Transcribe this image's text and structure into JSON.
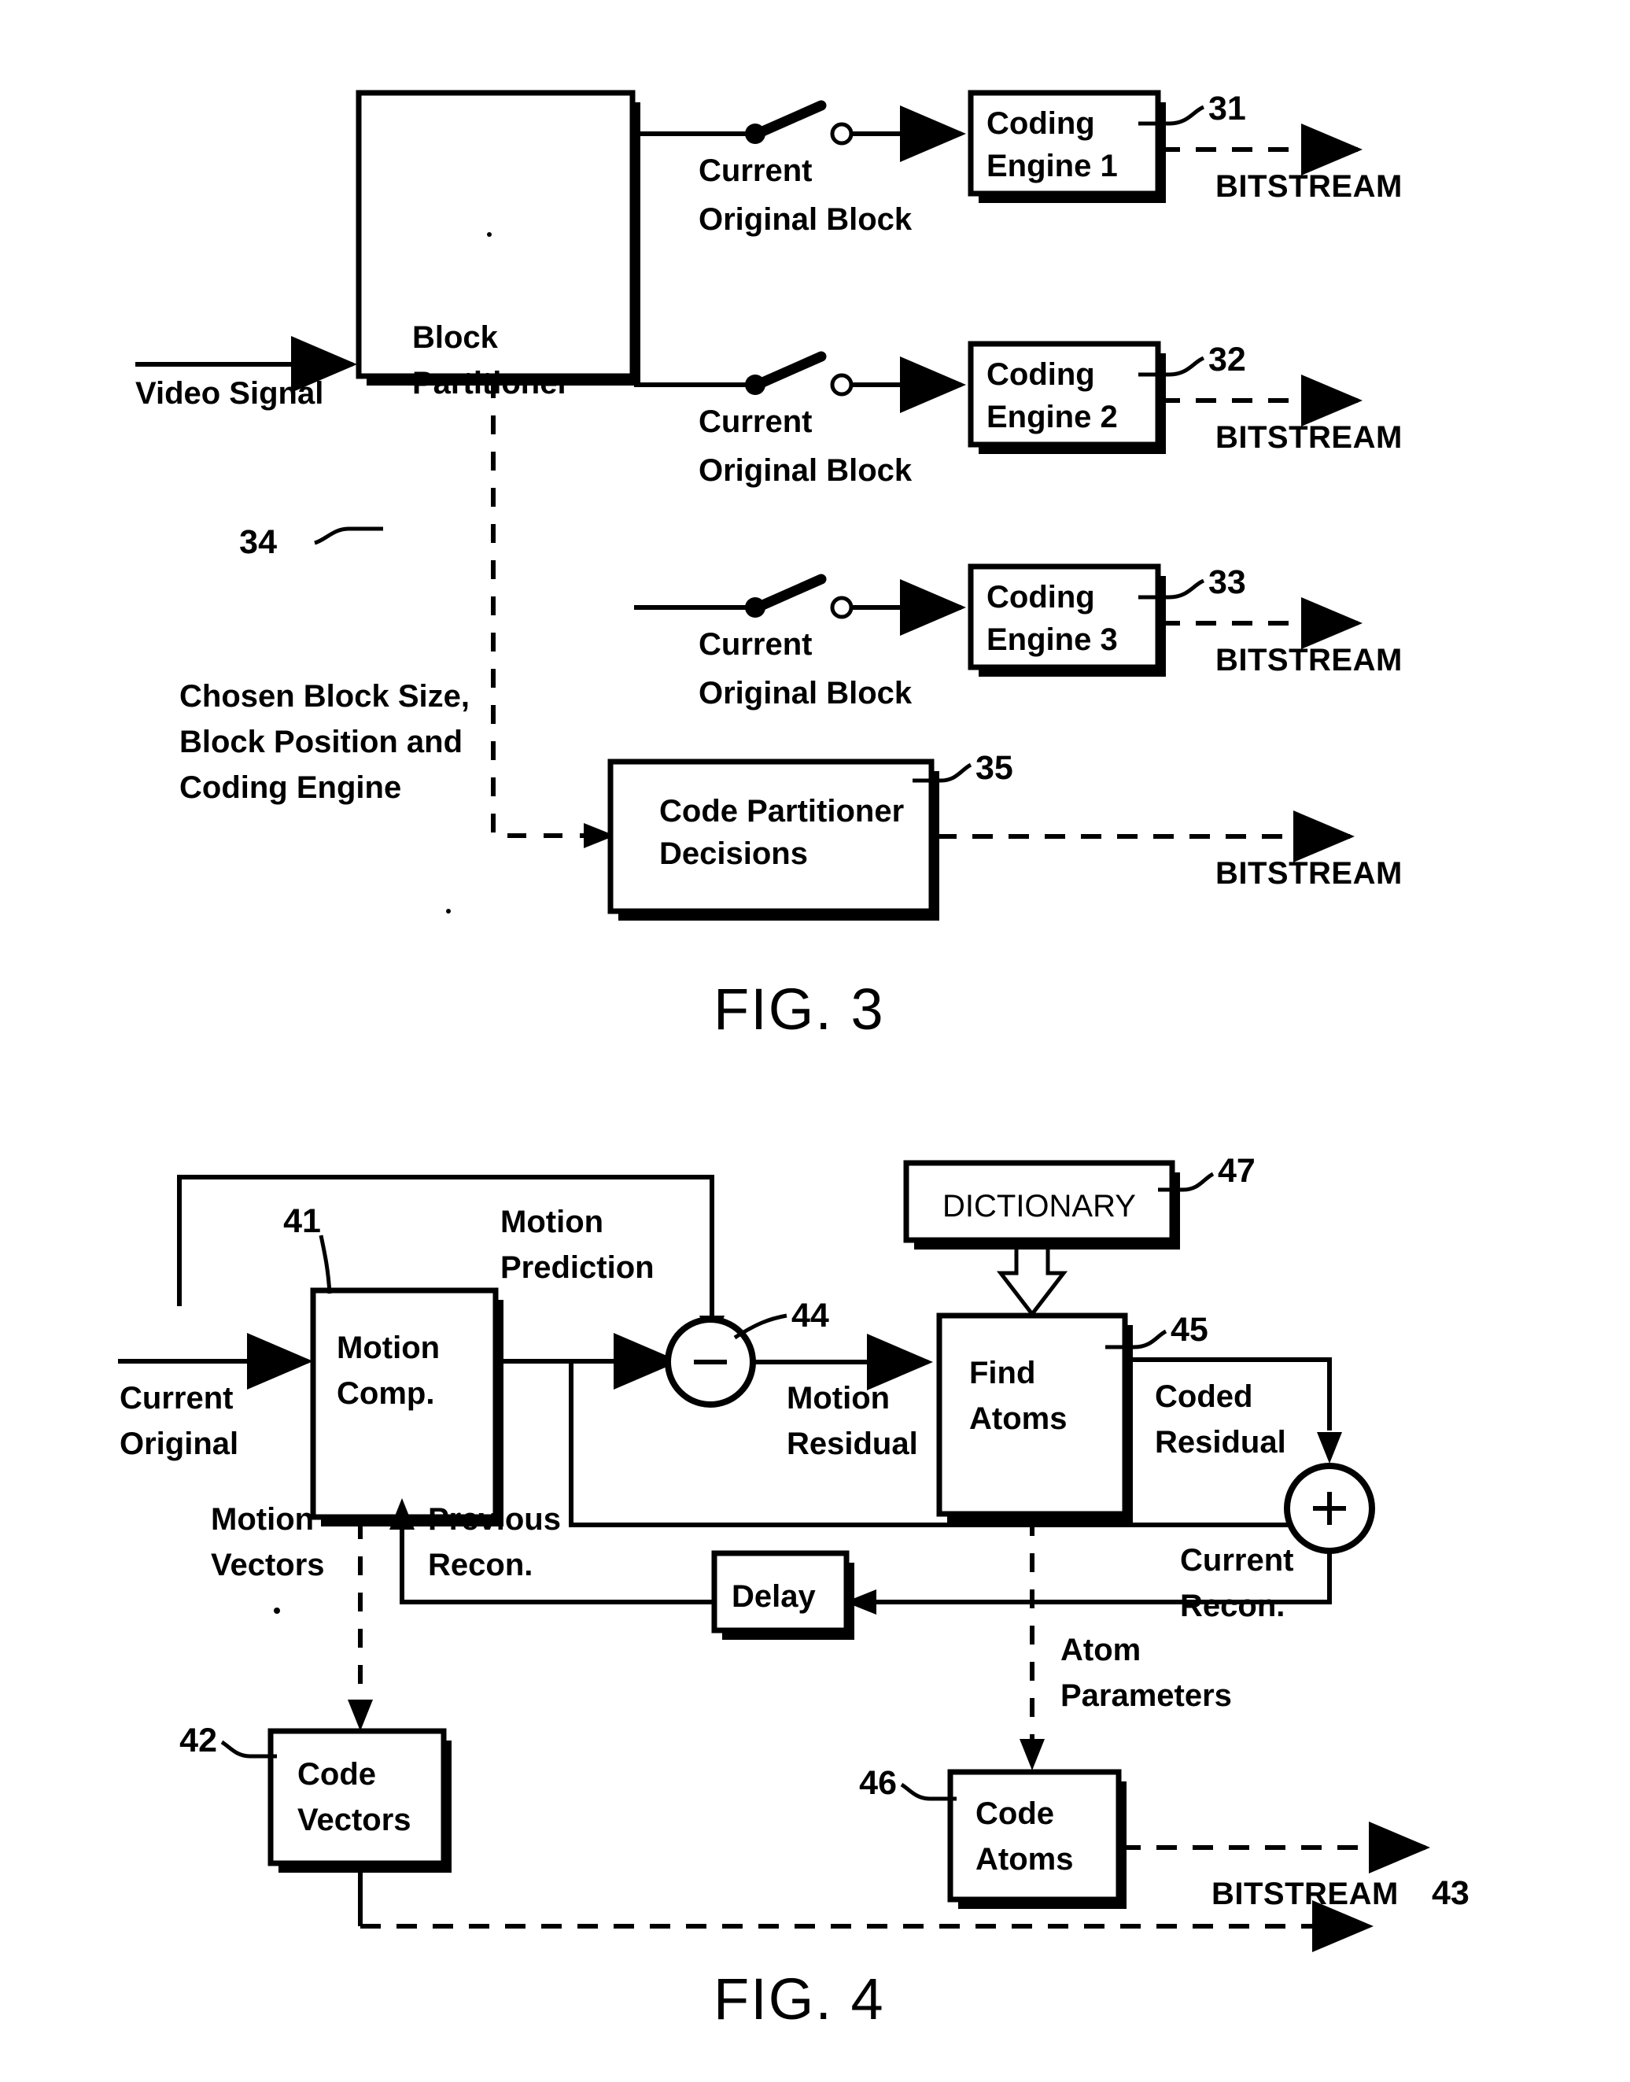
{
  "figures": [
    {
      "caption": "FIG. 3",
      "input_label": "Video Signal",
      "partitioner": {
        "line1": "Block",
        "line2": "Partitioner",
        "ref": "34"
      },
      "branches": [
        {
          "signal_l1": "Current",
          "signal_l2": "Original Block",
          "engine_l1": "Coding",
          "engine_l2": "Engine 1",
          "ref": "31",
          "output": "BITSTREAM"
        },
        {
          "signal_l1": "Current",
          "signal_l2": "Original Block",
          "engine_l1": "Coding",
          "engine_l2": "Engine 2",
          "ref": "32",
          "output": "BITSTREAM"
        },
        {
          "signal_l1": "Current",
          "signal_l2": "Original Block",
          "engine_l1": "Coding",
          "engine_l2": "Engine 3",
          "ref": "33",
          "output": "BITSTREAM"
        }
      ],
      "decisions_note": {
        "line1": "Chosen Block Size,",
        "line2": "Block Position and",
        "line3": "Coding Engine"
      },
      "decisions_box": {
        "line1": "Code Partitioner",
        "line2": "Decisions",
        "ref": "35",
        "output": "BITSTREAM"
      }
    },
    {
      "caption": "FIG. 4",
      "input_l1": "Current",
      "input_l2": "Original",
      "motion_comp": {
        "line1": "Motion",
        "line2": "Comp.",
        "ref": "41"
      },
      "motion_prediction_l1": "Motion",
      "motion_prediction_l2": "Prediction",
      "subtractor": {
        "sign": "−",
        "ref": "44"
      },
      "motion_residual_l1": "Motion",
      "motion_residual_l2": "Residual",
      "dictionary": {
        "label": "DICTIONARY",
        "ref": "47"
      },
      "find_atoms": {
        "line1": "Find",
        "line2": "Atoms",
        "ref": "45"
      },
      "coded_residual_l1": "Coded",
      "coded_residual_l2": "Residual",
      "adder": {
        "sign": "+"
      },
      "current_recon_l1": "Current",
      "current_recon_l2": "Recon.",
      "delay": {
        "label": "Delay"
      },
      "previous_recon_l1": "Previous",
      "previous_recon_l2": "Recon.",
      "motion_vectors_l1": "Motion",
      "motion_vectors_l2": "Vectors",
      "code_vectors": {
        "line1": "Code",
        "line2": "Vectors",
        "ref": "42"
      },
      "atom_parameters_l1": "Atom",
      "atom_parameters_l2": "Parameters",
      "code_atoms": {
        "line1": "Code",
        "line2": "Atoms",
        "ref": "46"
      },
      "bitstream_label": "BITSTREAM",
      "bitstream_ref": "43"
    }
  ]
}
